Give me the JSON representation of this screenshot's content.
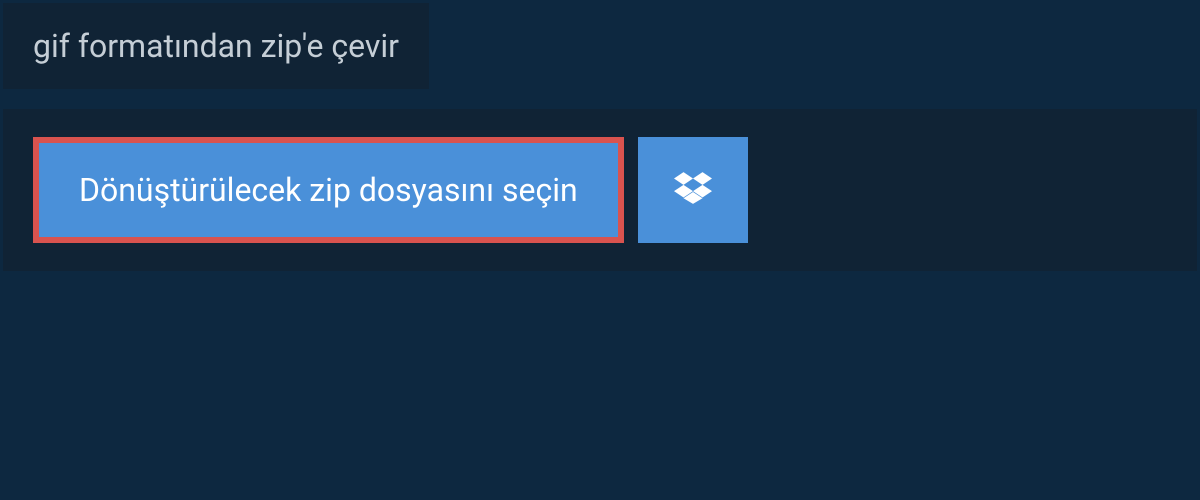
{
  "header": {
    "title": "gif formatından zip'e çevir"
  },
  "actions": {
    "select_file_label": "Dönüştürülecek zip dosyasını seçin",
    "dropbox_icon": "dropbox-icon"
  },
  "colors": {
    "background": "#0d2840",
    "panel": "#102335",
    "button": "#4a90d9",
    "highlight_border": "#d9534f",
    "text_light": "#c5ced6"
  }
}
